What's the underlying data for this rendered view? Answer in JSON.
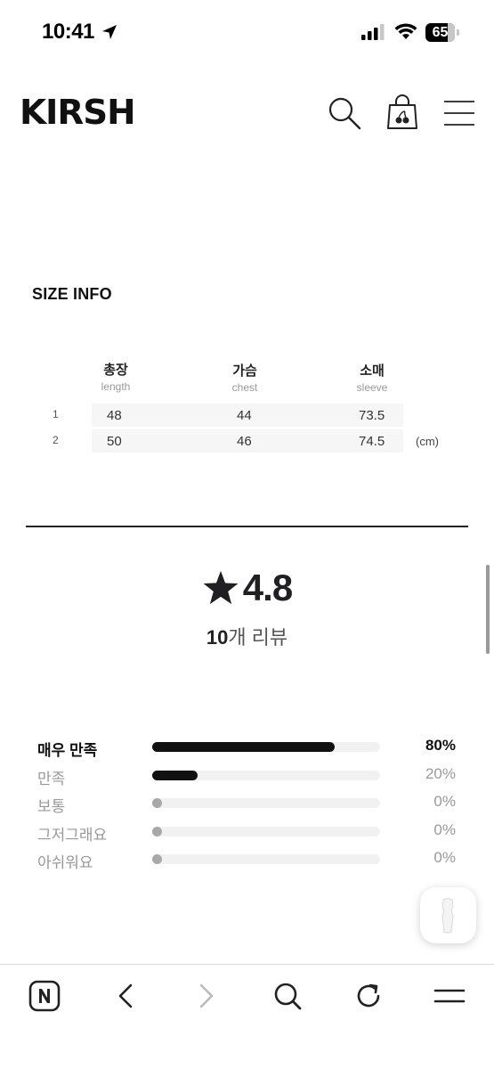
{
  "status_bar": {
    "time": "10:41",
    "battery": "65"
  },
  "header": {
    "logo": "KIRSH",
    "icons": [
      "search-icon",
      "shopping-bag-icon",
      "menu-icon"
    ]
  },
  "size_info": {
    "title": "SIZE INFO",
    "columns": [
      {
        "ko": "총장",
        "en": "length"
      },
      {
        "ko": "가슴",
        "en": "chest"
      },
      {
        "ko": "소매",
        "en": "sleeve"
      }
    ],
    "rows": [
      {
        "num": "1",
        "values": [
          "48",
          "44",
          "73.5"
        ]
      },
      {
        "num": "2",
        "values": [
          "50",
          "46",
          "74.5"
        ]
      }
    ],
    "unit": "(cm)"
  },
  "rating": {
    "score": "4.8",
    "review_count_num": "10",
    "review_count_label": "개 리뷰"
  },
  "distribution": [
    {
      "label": "매우 만족",
      "percent_text": "80%",
      "fraction": 0.8
    },
    {
      "label": "만족",
      "percent_text": "20%",
      "fraction": 0.2
    },
    {
      "label": "보통",
      "percent_text": "0%",
      "fraction": 0
    },
    {
      "label": "그저그래요",
      "percent_text": "0%",
      "fraction": 0
    },
    {
      "label": "아쉬워요",
      "percent_text": "0%",
      "fraction": 0
    }
  ],
  "toolbar": {
    "icons": [
      "naver-home-icon",
      "back-icon",
      "forward-icon",
      "search-icon",
      "reload-icon",
      "menu-icon"
    ]
  },
  "colors": {
    "accent": "#111111",
    "muted": "#999999",
    "track": "#f1f1f1"
  }
}
